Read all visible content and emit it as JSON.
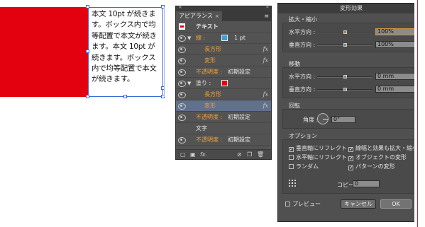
{
  "artboard": {
    "fill_color": "#e3000f",
    "text_lines": [
      "本文 10pt が続きま",
      "す。ボックス内で均",
      "等配置で本文が続き",
      "ます。本文 10pt が",
      "続きます。ボックス",
      "内で均等配置で本文",
      "が続きます。"
    ]
  },
  "appearance": {
    "close": "×",
    "collapse": "«",
    "tab_label": "アピアランス",
    "tab_close": "×",
    "menu_icon": "≡",
    "rows": [
      {
        "label": "テキスト",
        "kind": "header"
      },
      {
        "label": "線 :",
        "value": "1 pt",
        "swatch": "#3aa0e0",
        "kind": "stroke"
      },
      {
        "label": "長方形",
        "kind": "effect"
      },
      {
        "label": "変形",
        "kind": "effect"
      },
      {
        "label": "不透明度 :",
        "value": "初期設定",
        "kind": "opacity"
      },
      {
        "label": "塗り :",
        "swatch": "#e3000f",
        "kind": "fill"
      },
      {
        "label": "長方形",
        "kind": "effect"
      },
      {
        "label": "変形",
        "kind": "effect-selected"
      },
      {
        "label": "不透明度 :",
        "value": "初期設定",
        "kind": "opacity"
      },
      {
        "label": "文字",
        "kind": "plain"
      },
      {
        "label": "不透明度 :",
        "value": "初期設定",
        "kind": "opacity"
      }
    ],
    "fx_label": "fx",
    "bottom_buttons": [
      "▢",
      "▣",
      "fx.",
      "⊘",
      "❐",
      "🗑"
    ]
  },
  "transform_dialog": {
    "title": "変形効果",
    "scale": {
      "label": "拡大・縮小",
      "horizontal_label": "水平方向 :",
      "horizontal_value": "100%",
      "vertical_label": "垂直方向 :",
      "vertical_value": "100%"
    },
    "move": {
      "label": "移動",
      "horizontal_label": "水平方向 :",
      "horizontal_value": "0 mm",
      "vertical_label": "垂直方向 :",
      "vertical_value": "0 mm"
    },
    "rotate": {
      "label": "回転",
      "angle_label": "角度 :",
      "angle_value": "0°"
    },
    "options": {
      "label": "オプション",
      "items": [
        {
          "label": "垂直軸にリフレクト",
          "checked": true
        },
        {
          "label": "線幅と効果も拡大・縮小",
          "checked": true
        },
        {
          "label": "水平軸にリフレクト",
          "checked": false
        },
        {
          "label": "オブジェクトの変形",
          "checked": true
        },
        {
          "label": "ランダム",
          "checked": false
        },
        {
          "label": "パターンの変形",
          "checked": true
        }
      ],
      "copies_label": "コピー",
      "copies_value": "0"
    },
    "preview_label": "プレビュー",
    "cancel_label": "キャンセル",
    "ok_label": "OK"
  }
}
